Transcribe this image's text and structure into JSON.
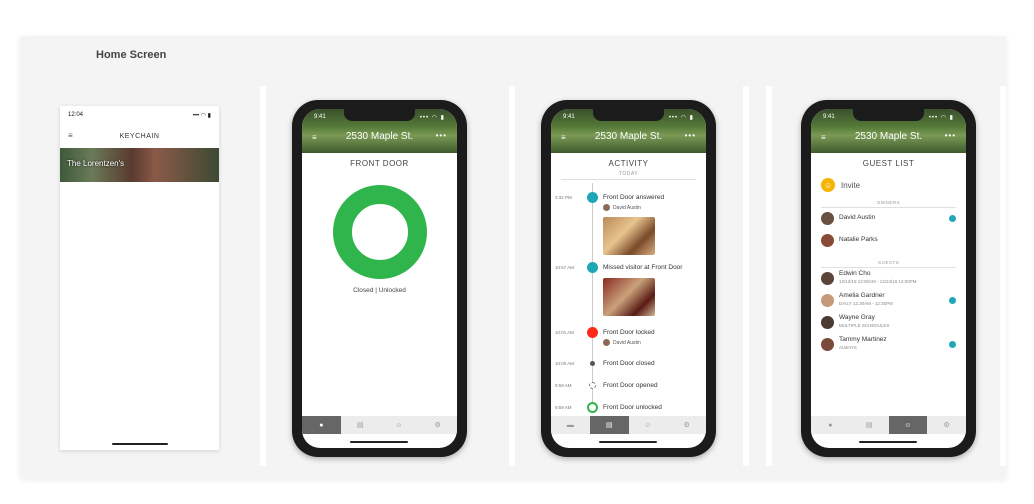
{
  "page_heading": "Home Screen",
  "phone1": {
    "time": "12:04",
    "status_icons": "••• ◠ ▮",
    "menu_icon": "≡",
    "title": "KEYCHAIN",
    "card_label": "The Lorentzen's"
  },
  "header": {
    "time": "9:41",
    "signal": "••• ◠ ▮",
    "menu_icon": "≡",
    "address": "2530 Maple St.",
    "more": "•••"
  },
  "phone2": {
    "section_title": "FRONT DOOR",
    "status": "Closed | Unlocked"
  },
  "phone3": {
    "section_title": "ACTIVITY",
    "today": "TODAY",
    "events": [
      {
        "time": "3:32 PM",
        "label": "Front Door answered",
        "who": "David Austin"
      },
      {
        "time": "10:57 AM",
        "label": "Missed visitor at Front Door"
      },
      {
        "time": "10:01 AM",
        "label": "Front Door locked",
        "who": "David Austin"
      },
      {
        "time": "10:00 AM",
        "label": "Front Door closed"
      },
      {
        "time": "9:59 AM",
        "label": "Front Door opened"
      },
      {
        "time": "9:59 AM",
        "label": "Front Door unlocked"
      }
    ]
  },
  "phone4": {
    "section_title": "GUEST LIST",
    "invite": "Invite",
    "owners_label": "OWNERS",
    "owners": [
      {
        "name": "David Austin"
      },
      {
        "name": "Natalie Parks"
      }
    ],
    "guests_label": "GUESTS",
    "guests": [
      {
        "name": "Edwin Cho",
        "schedule": "12/12/16 12:00AM - 12/24/16 12:00PM"
      },
      {
        "name": "Amelia Gardner",
        "schedule": "DAILY 12:30AM - 12:30PM"
      },
      {
        "name": "Wayne Gray",
        "schedule": "MULTIPLE SCHEDULES"
      },
      {
        "name": "Tammy Martinez",
        "schedule": "ALWAYS"
      }
    ]
  },
  "tabs": {
    "home_icon": "●",
    "activity_icon": "▤",
    "guests_icon": "☺",
    "settings_icon": "⚙",
    "video_icon": "▬"
  },
  "colors": {
    "ring": "#2fb54b",
    "accent_teal": "#20a7b7",
    "lock_red": "#ff2a1a",
    "invite_yellow": "#f4b400"
  }
}
